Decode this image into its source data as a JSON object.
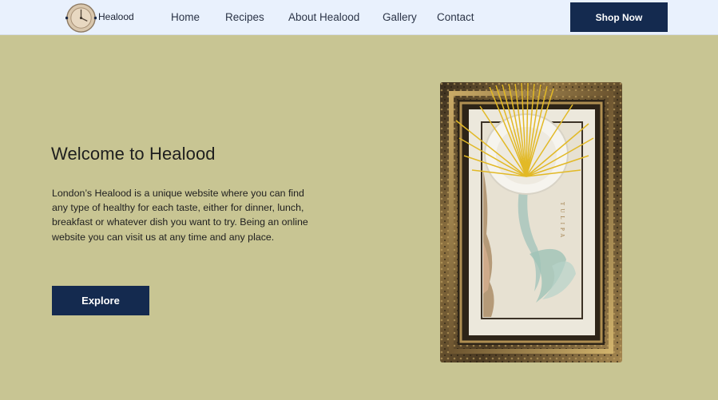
{
  "brand": {
    "name": "Healood",
    "logo_icon": "plate-clock-logo-icon"
  },
  "nav": {
    "items": [
      {
        "label": "Home"
      },
      {
        "label": "Recipes"
      },
      {
        "label": "About Healood"
      },
      {
        "label": "Gallery"
      },
      {
        "label": "Contact"
      }
    ],
    "cta_label": "Shop Now"
  },
  "hero": {
    "title": "Welcome to Healood",
    "description": "London’s Healood is a unique website where you can find any type of healthy for each taste, either for dinner, lunch, breakfast or whatever dish you want to try. Being an online website you can visit us at any time and any place.",
    "button_label": "Explore",
    "image_caption": "TULIPA"
  },
  "colors": {
    "background": "#c8c593",
    "navbar": "#e9f1fd",
    "button": "#142a4f",
    "button_text": "#ffffff"
  }
}
